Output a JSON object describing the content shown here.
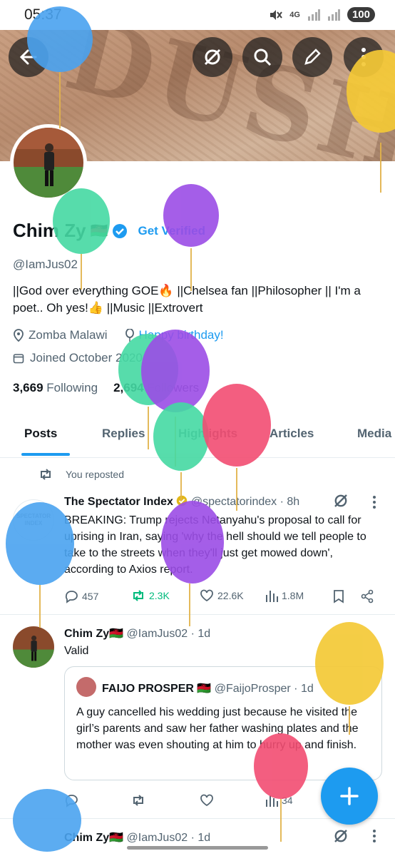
{
  "status": {
    "time": "05:37",
    "network": "4G",
    "battery": "100"
  },
  "header": {
    "banner_text": "DUSH"
  },
  "profile": {
    "name": "Chim Zy",
    "flag": "🇲🇼",
    "get_verified": "Get Verified",
    "handle": "@IamJus02",
    "bio": "||God over everything GOE🔥 ||Chelsea fan ||Philosopher || I'm a poet.. Oh yes!👍 ||Music ||Extrovert",
    "location": "Zomba Malawi",
    "birthday": "Happy birthday!",
    "joined": "Joined October 2020",
    "following_count": "3,669",
    "following_label": "Following",
    "followers_count": "2,694",
    "followers_label": "Followers"
  },
  "tabs": [
    "Posts",
    "Replies",
    "Highlights",
    "Articles",
    "Media"
  ],
  "posts": [
    {
      "reposted": "You reposted",
      "avatar_text": "SPECTATOR INDEX",
      "author": "The Spectator Index",
      "handle": "@spectatorindex",
      "time": "8h",
      "text": "BREAKING: Trump rejects Netanyahu's proposal to call for uprising in Iran, saying 'why the hell should we tell people to take to the streets when they'll just get mowed down', according to Axios report.",
      "replies": "457",
      "reposts": "2.3K",
      "likes": "22.6K",
      "views": "1.8M"
    },
    {
      "author": "Chim Zy🇲🇼",
      "handle": "@IamJus02",
      "time": "1d",
      "text": "Valid",
      "quote": {
        "author": "FAIJO PROSPER 🇲🇼",
        "handle": "@FaijoProsper",
        "time": "1d",
        "text": "A guy cancelled his wedding just because he visited the girl’s parents and saw  her father washing plates and the mother was even shouting at him to hurry up and finish."
      },
      "views": "34"
    },
    {
      "author": "Chim Zy🇲🇼",
      "handle": "@IamJus02",
      "time": "1d"
    }
  ],
  "colors": {
    "accent": "#1d9bf0",
    "repost_green": "#00ba7c",
    "text": "#0f1419",
    "muted": "#536471"
  }
}
